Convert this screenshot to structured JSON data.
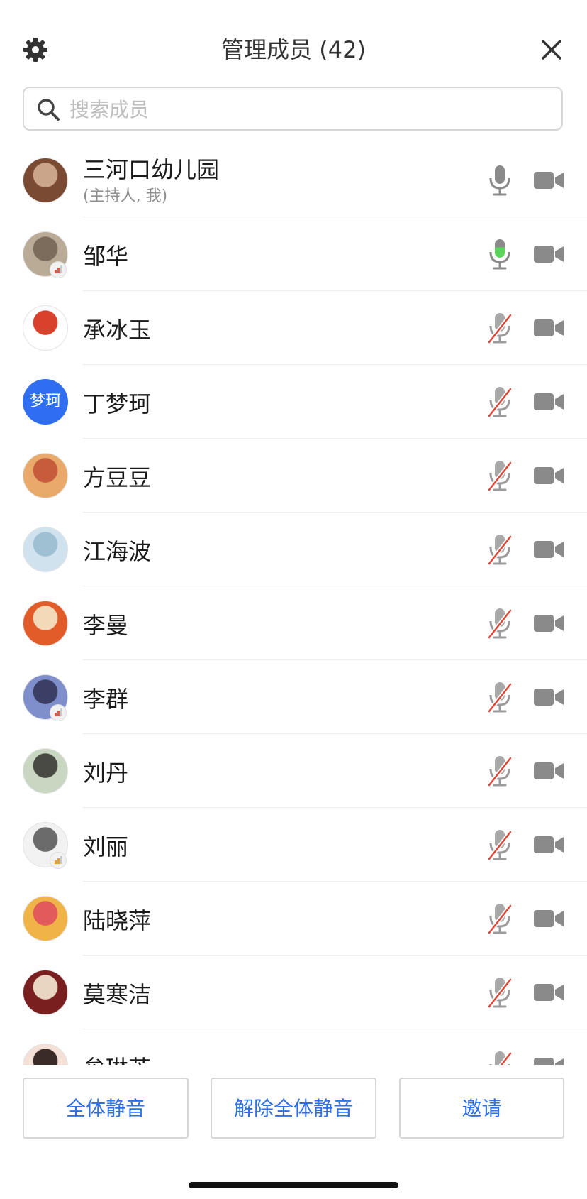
{
  "header": {
    "title": "管理成员 (42)"
  },
  "search": {
    "placeholder": "搜索成员"
  },
  "members": [
    {
      "name": "三河口幼儿园",
      "sub": "(主持人, 我)",
      "avatar": "photo",
      "colors": [
        "#7a4a32",
        "#caa58a"
      ],
      "mic": "on",
      "signal": null
    },
    {
      "name": "邹华",
      "sub": "",
      "avatar": "photo",
      "colors": [
        "#b9ab96",
        "#7c6c5c"
      ],
      "mic": "speaking",
      "signal": "#e05a47"
    },
    {
      "name": "承冰玉",
      "sub": "",
      "avatar": "photo",
      "colors": [
        "#ffffff",
        "#d9412c"
      ],
      "mic": "muted",
      "signal": null
    },
    {
      "name": "丁梦珂",
      "sub": "",
      "avatar": "text",
      "avatar_text": "梦珂",
      "colors": [
        "#2f6ef0",
        "#2f6ef0"
      ],
      "mic": "muted",
      "signal": null
    },
    {
      "name": "方豆豆",
      "sub": "",
      "avatar": "photo",
      "colors": [
        "#e8a96a",
        "#c65c3c"
      ],
      "mic": "muted",
      "signal": null
    },
    {
      "name": "江海波",
      "sub": "",
      "avatar": "photo",
      "colors": [
        "#cfe2ee",
        "#9fbfd3"
      ],
      "mic": "muted",
      "signal": null
    },
    {
      "name": "李曼",
      "sub": "",
      "avatar": "photo",
      "colors": [
        "#e25c2a",
        "#f4d9b8"
      ],
      "mic": "muted",
      "signal": null
    },
    {
      "name": "李群",
      "sub": "",
      "avatar": "photo",
      "colors": [
        "#7f8fcc",
        "#3b3f66"
      ],
      "mic": "muted",
      "signal": "#e05a47"
    },
    {
      "name": "刘丹",
      "sub": "",
      "avatar": "photo",
      "colors": [
        "#c9d6c2",
        "#4a4a44"
      ],
      "mic": "muted",
      "signal": null
    },
    {
      "name": "刘丽",
      "sub": "",
      "avatar": "photo",
      "colors": [
        "#f2f2f2",
        "#6b6b6b"
      ],
      "mic": "muted",
      "signal": "#f29b28"
    },
    {
      "name": "陆晓萍",
      "sub": "",
      "avatar": "photo",
      "colors": [
        "#f0b347",
        "#e25a5a"
      ],
      "mic": "muted",
      "signal": null
    },
    {
      "name": "莫寒洁",
      "sub": "",
      "avatar": "photo",
      "colors": [
        "#7a1f1f",
        "#e9d6c2"
      ],
      "mic": "muted",
      "signal": null
    },
    {
      "name": "牟琳芝",
      "sub": "",
      "avatar": "photo",
      "colors": [
        "#f4e0d6",
        "#3a2a28"
      ],
      "mic": "muted",
      "signal": null
    }
  ],
  "footer": {
    "mute_all": "全体静音",
    "unmute_all": "解除全体静音",
    "invite": "邀请"
  },
  "icons": {
    "settings": "gear-icon",
    "close": "close-icon",
    "search": "search-icon",
    "mic": "microphone-icon",
    "camera": "video-camera-icon"
  },
  "colors": {
    "accent": "#2c6fe8",
    "speaking": "#5ed35e",
    "muted_slash": "#e0483a",
    "icon_gray": "#8a8a8a"
  }
}
